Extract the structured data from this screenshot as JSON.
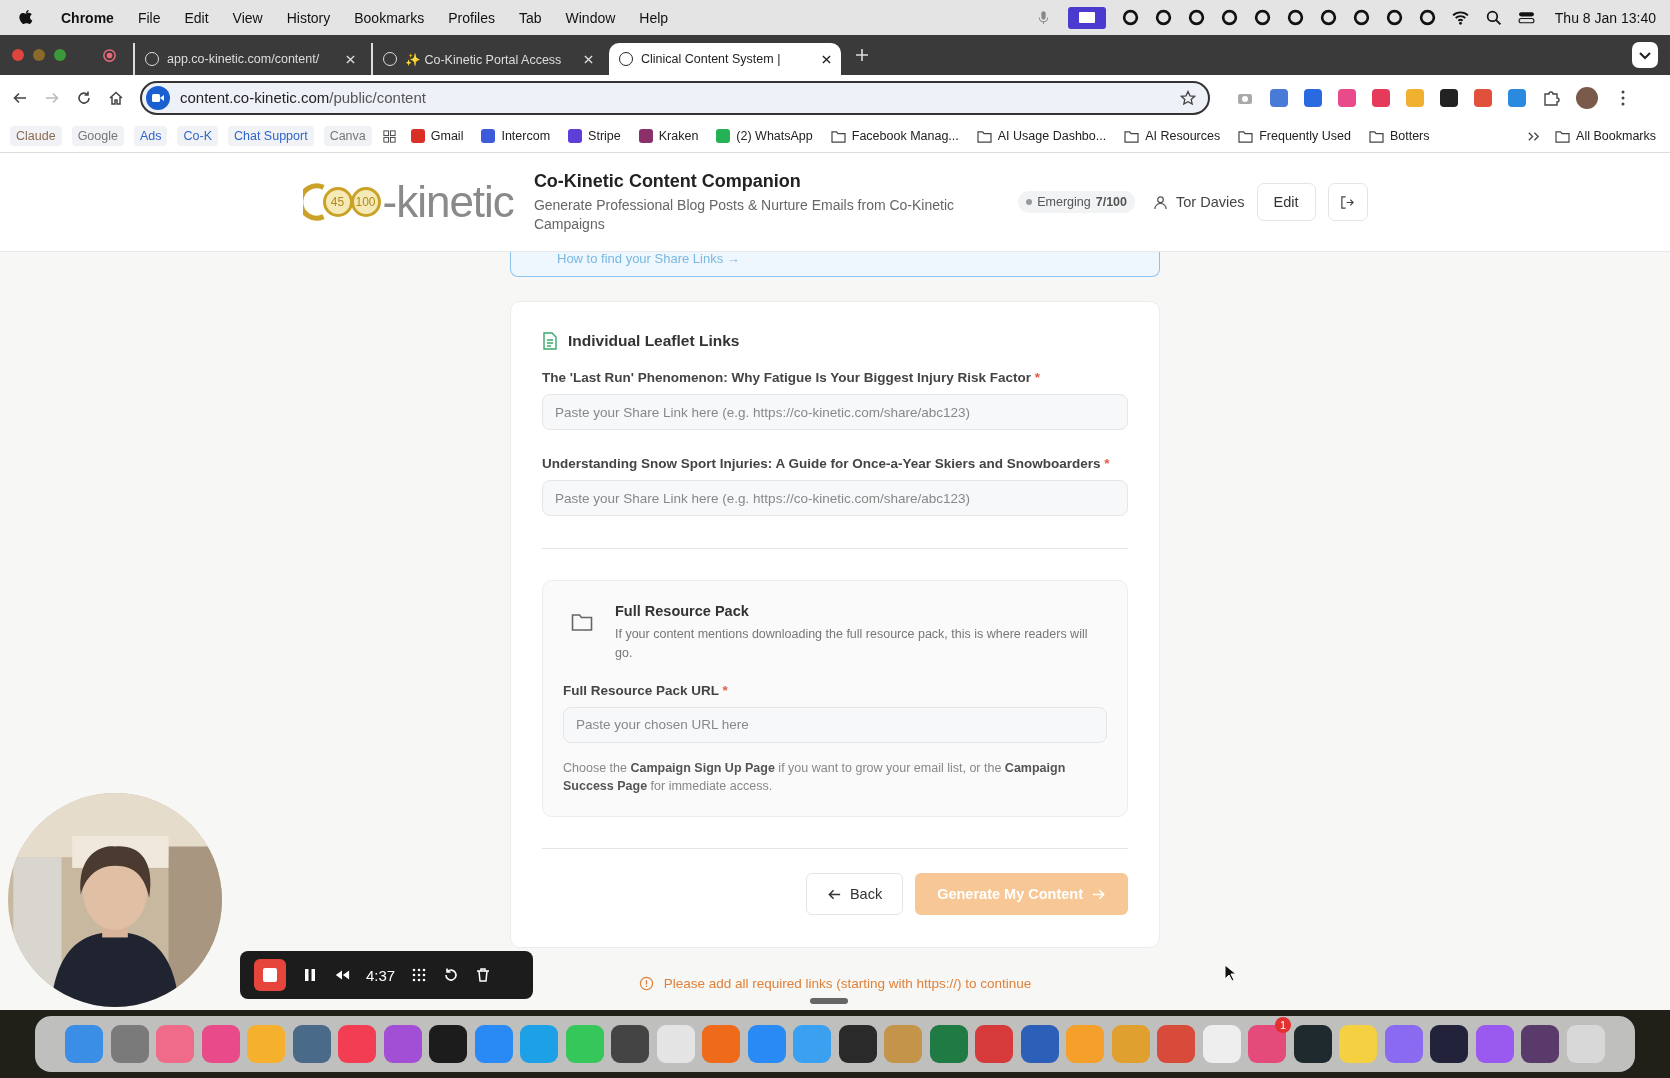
{
  "menu_bar": {
    "app": "Chrome",
    "menus": [
      "File",
      "Edit",
      "View",
      "History",
      "Bookmarks",
      "Profiles",
      "Tab",
      "Window",
      "Help"
    ],
    "clock": "Thu 8 Jan  13:40"
  },
  "tabs": [
    {
      "title": "app.co-kinetic.com/content/",
      "selected": false
    },
    {
      "title": "✨ Co-Kinetic Portal Access",
      "selected": false
    },
    {
      "title": "Clinical Content System |",
      "selected": true
    }
  ],
  "address_bar": {
    "host": "content.co-kinetic.com",
    "path": "/public/content"
  },
  "bookmarks": [
    {
      "label": "Claude",
      "kind": "chip",
      "color": "#8a6a50"
    },
    {
      "label": "Google",
      "kind": "chip",
      "color": "#777777"
    },
    {
      "label": "Ads",
      "kind": "chip",
      "color": "#2f66c9"
    },
    {
      "label": "Co-K",
      "kind": "chip",
      "color": "#2f66c9"
    },
    {
      "label": "Chat Support",
      "kind": "chip",
      "color": "#2f66c9"
    },
    {
      "label": "Canva",
      "kind": "chip",
      "color": "#777777"
    },
    {
      "label": "Gmail",
      "kind": "site",
      "color": "#d93025"
    },
    {
      "label": "Intercom",
      "kind": "site",
      "color": "#3b5bdb"
    },
    {
      "label": "Stripe",
      "kind": "site",
      "color": "#5b3fd6"
    },
    {
      "label": "Kraken",
      "kind": "site",
      "color": "#8b2f6b"
    },
    {
      "label": "(2) WhatsApp",
      "kind": "site",
      "color": "#25b155"
    },
    {
      "label": "Facebook Manag...",
      "kind": "folder"
    },
    {
      "label": "AI Usage Dashbo...",
      "kind": "folder"
    },
    {
      "label": "AI Resources",
      "kind": "folder"
    },
    {
      "label": "Frequently Used",
      "kind": "folder"
    },
    {
      "label": "Botters",
      "kind": "folder"
    }
  ],
  "all_bookmarks": "All Bookmarks",
  "header": {
    "logo_badges": [
      "45",
      "100"
    ],
    "logo_text": "-kinetic",
    "title": "Co-Kinetic Content Companion",
    "subtitle": "Generate Professional Blog Posts & Nurture Emails from Co-Kinetic Campaigns",
    "level_label": "Emerging",
    "level_score": "7/100",
    "user": "Tor Davies",
    "edit_button": "Edit"
  },
  "share_links_link": "How to find your Share Links →",
  "leaflet_section": {
    "title": "Individual Leaflet Links",
    "fields": [
      {
        "label": "The 'Last Run' Phenomenon: Why Fatigue Is Your Biggest Injury Risk Factor",
        "required_mark": "*",
        "placeholder": "Paste your Share Link here (e.g. https://co-kinetic.com/share/abc123)"
      },
      {
        "label": "Understanding Snow Sport Injuries: A Guide for Once-a-Year Skiers and Snowboarders",
        "required_mark": "*",
        "placeholder": "Paste your Share Link here (e.g. https://co-kinetic.com/share/abc123)"
      }
    ]
  },
  "resource_pack": {
    "title": "Full Resource Pack",
    "description": "If your content mentions downloading the full resource pack, this is where readers will go.",
    "field": {
      "label": "Full Resource Pack URL",
      "required_mark": "*",
      "placeholder": "Paste your chosen URL here"
    },
    "hint": "Choose the **Campaign Sign Up Page** if you want to grow your email list, or the **Campaign Success Page** for immediate access."
  },
  "actions": {
    "back": "Back",
    "generate": "Generate My Content",
    "generate_disabled": true
  },
  "error": "Please add all required links (starting with https://) to continue",
  "recorder": {
    "time": "4:37"
  },
  "dock": [
    {
      "color": "#3a8ee6"
    },
    {
      "color": "#7a7a7a"
    },
    {
      "color": "#f06a8a"
    },
    {
      "color": "#e84a8a"
    },
    {
      "color": "#f5b02e"
    },
    {
      "color": "#4a6a8a"
    },
    {
      "color": "#f23d52"
    },
    {
      "color": "#a24fd6"
    },
    {
      "color": "#1c1c1c"
    },
    {
      "color": "#2a8af5"
    },
    {
      "color": "#1ea0e6"
    },
    {
      "color": "#35c759"
    },
    {
      "color": "#444444"
    },
    {
      "color": "#e4e4e4"
    },
    {
      "color": "#f06a1c"
    },
    {
      "color": "#2a8af5"
    },
    {
      "color": "#3aa0f0"
    },
    {
      "color": "#2a2a2a"
    },
    {
      "color": "#c4944a"
    },
    {
      "color": "#1f7a44"
    },
    {
      "color": "#d63a3a"
    },
    {
      "color": "#2b5fb8"
    },
    {
      "color": "#f5a02a"
    },
    {
      "color": "#e0a030"
    },
    {
      "color": "#d84a3a"
    },
    {
      "color": "#eeeeee"
    },
    {
      "color": "#e44a7a"
    },
    {
      "color": "#1e2a2e"
    },
    {
      "color": "#f5d040"
    },
    {
      "color": "#8a6af0"
    },
    {
      "color": "#22233a"
    },
    {
      "color": "#9a5af0"
    },
    {
      "color": "#5a3a6a"
    },
    {
      "color": "#d8d8d8"
    }
  ],
  "dock_badge": "1"
}
